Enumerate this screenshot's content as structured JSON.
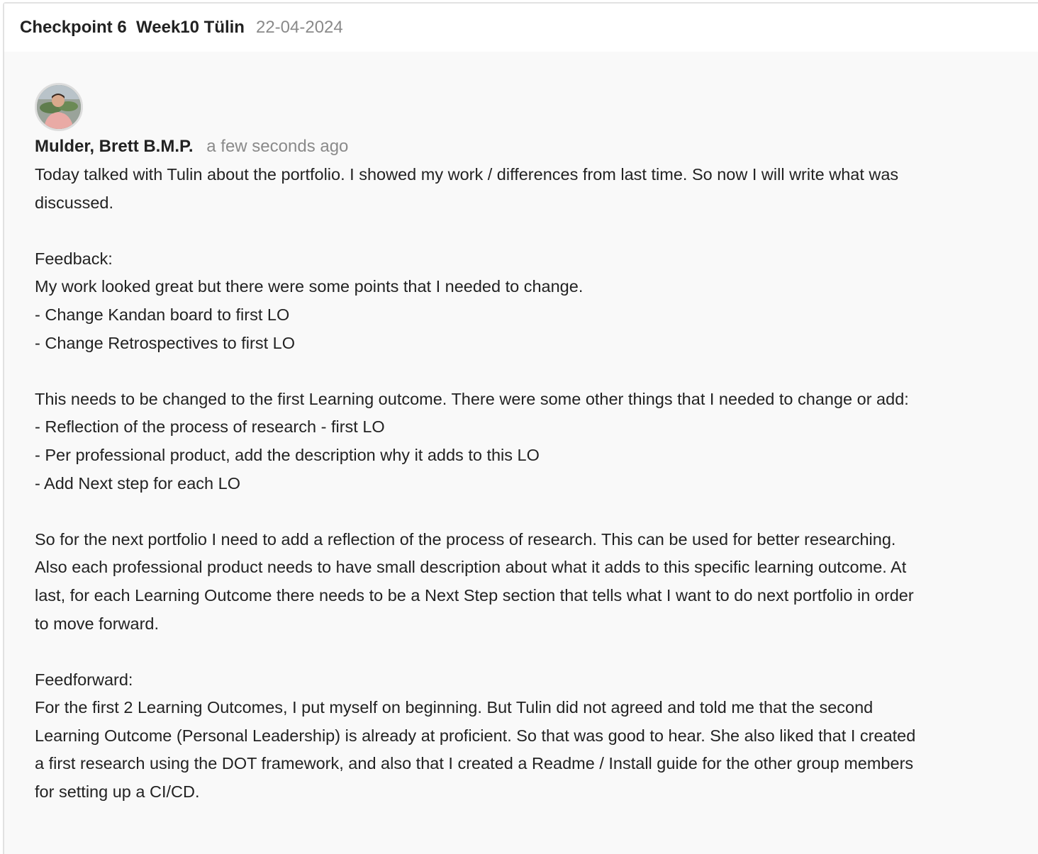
{
  "header": {
    "title": "Checkpoint 6  Week10 Tülin",
    "date": "22-04-2024"
  },
  "comment": {
    "author": "Mulder, Brett B.M.P.",
    "time": "a few seconds ago",
    "lines": [
      "Today talked with Tulin about the portfolio. I showed my work / differences from last time. So now I will write what was",
      "discussed.",
      "",
      "Feedback:",
      "My work looked great but there were some points that I needed to change.",
      "- Change Kandan board to first LO",
      "- Change Retrospectives to first LO",
      "",
      "This needs to be changed to the first Learning outcome. There were some other things that I needed to change or add:",
      "- Reflection of the process of research - first LO",
      "- Per professional product, add the description why it adds to this LO",
      "- Add Next step for each LO",
      "",
      "So for the next portfolio I need to add a reflection of the process of research. This can be used for better researching.",
      "Also each professional product needs to have small description about what it adds to this specific learning outcome. At",
      "last, for each Learning Outcome there needs to be a Next Step section that tells what I want to do next portfolio in order",
      "to move forward.",
      "",
      "Feedforward:",
      "For the first 2 Learning Outcomes, I put myself on beginning. But Tulin did not agreed and told me that the second",
      "Learning Outcome (Personal Leadership) is already at proficient. So that was good to hear. She also liked that I created",
      "a first research using the DOT framework, and also that I created a Readme / Install guide for the other group members",
      "for setting up a CI/CD."
    ]
  }
}
